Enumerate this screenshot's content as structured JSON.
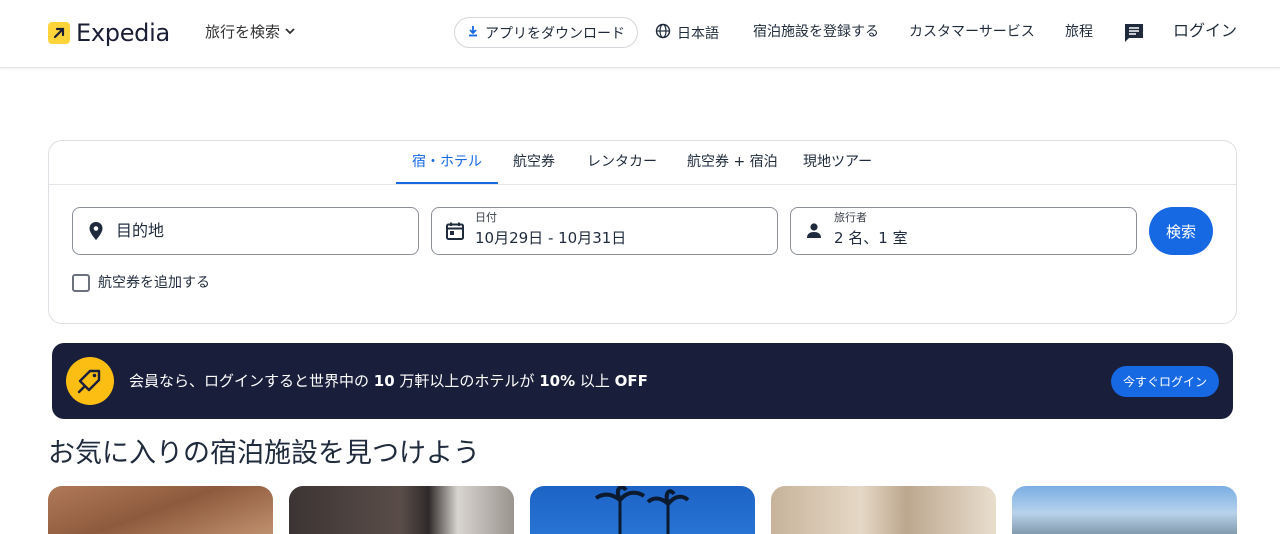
{
  "header": {
    "logo_text": "Expedia",
    "trip_search": "旅行を検索",
    "app_download": "アプリをダウンロード",
    "language": "日本語",
    "list_property": "宿泊施設を登録する",
    "customer_service": "カスタマーサービス",
    "trips": "旅程",
    "login": "ログイン"
  },
  "search": {
    "tabs": [
      {
        "label": "宿・ホテル",
        "active": true
      },
      {
        "label": "航空券",
        "active": false
      },
      {
        "label": "レンタカー",
        "active": false
      },
      {
        "label": "航空券 + 宿泊",
        "active": false
      },
      {
        "label": "現地ツアー",
        "active": false
      }
    ],
    "destination": {
      "placeholder": "目的地"
    },
    "dates": {
      "label": "日付",
      "value": "10月29日 - 10月31日"
    },
    "travelers": {
      "label": "旅行者",
      "value": "2 名、1 室"
    },
    "search_button": "検索",
    "add_flight": "航空券を追加する"
  },
  "promo": {
    "text_before": "会員なら、ログインすると世界中の ",
    "text_bold1": "10",
    "text_mid": " 万軒以上のホテルが ",
    "text_bold2": "10%",
    "text_mid2": " 以上 ",
    "text_bold3": "OFF",
    "button": "今すぐログイン"
  },
  "section": {
    "title": "お気に入りの宿泊施設を見つけよう"
  },
  "colors": {
    "accent": "#1668e3",
    "brand_yellow": "#ffd43b",
    "promo_bg": "#191e3b",
    "promo_icon": "#fdbe13"
  }
}
